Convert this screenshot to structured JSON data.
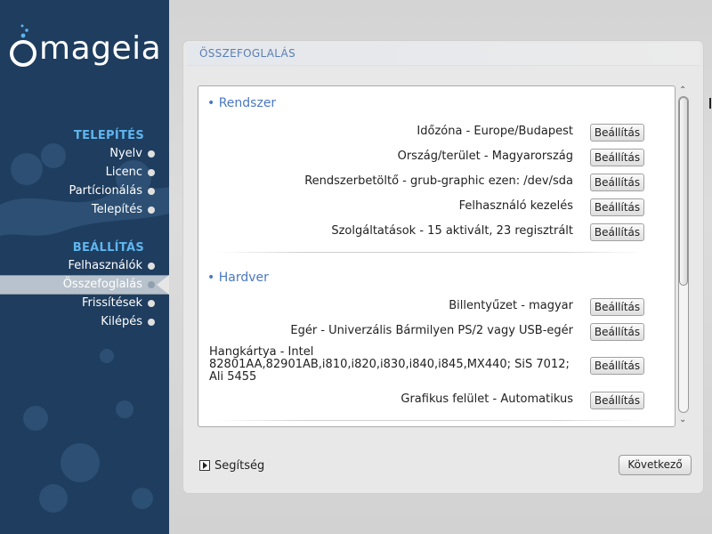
{
  "brand": {
    "name": "mageia"
  },
  "sidebar": {
    "install_title": "TELEPÍTÉS",
    "install_steps": [
      "Nyelv",
      "Licenc",
      "Partícionálás",
      "Telepítés"
    ],
    "config_title": "BEÁLLÍTÁS",
    "config_steps": [
      "Felhasználók",
      "Összefoglalás",
      "Frissítések",
      "Kilépés"
    ],
    "current_step": "Összefoglalás"
  },
  "panel": {
    "title": "ÖSSZEFOGLALÁS"
  },
  "sections": [
    {
      "title": "• Rendszer",
      "items": [
        {
          "label": "Időzóna - Europe/Budapest",
          "button": "Beállítás"
        },
        {
          "label": "Ország/terület - Magyarország",
          "button": "Beállítás"
        },
        {
          "label": "Rendszerbetöltő - grub-graphic ezen: /dev/sda",
          "button": "Beállítás"
        },
        {
          "label": "Felhasználó kezelés",
          "button": "Beállítás"
        },
        {
          "label": "Szolgáltatások - 15 aktivált, 23 regisztrált",
          "button": "Beállítás"
        }
      ]
    },
    {
      "title": "• Hardver",
      "items": [
        {
          "label": "Billentyűzet - magyar",
          "button": "Beállítás"
        },
        {
          "label": "Egér - Univerzális Bármilyen PS/2 vagy USB-egér",
          "button": "Beállítás"
        },
        {
          "label": "Hangkártya - Intel 82801AA,82901AB,i810,i820,i830,i840,i845,MX440; SiS 7012; Ali 5455",
          "button": "Beállítás"
        },
        {
          "label": "Grafikus felület - Automatikus",
          "button": "Beállítás"
        }
      ]
    }
  ],
  "scrollbar": {
    "position_fraction": 0.0,
    "visible_fraction": 0.6
  },
  "footer": {
    "help_label": "Segítség",
    "next_label": "Következő"
  },
  "colors": {
    "sidebar_bg": "#1f3d5e",
    "section_title": "#5fb5ee",
    "category": "#4a78c2",
    "panel_title": "#5b7fb5"
  }
}
